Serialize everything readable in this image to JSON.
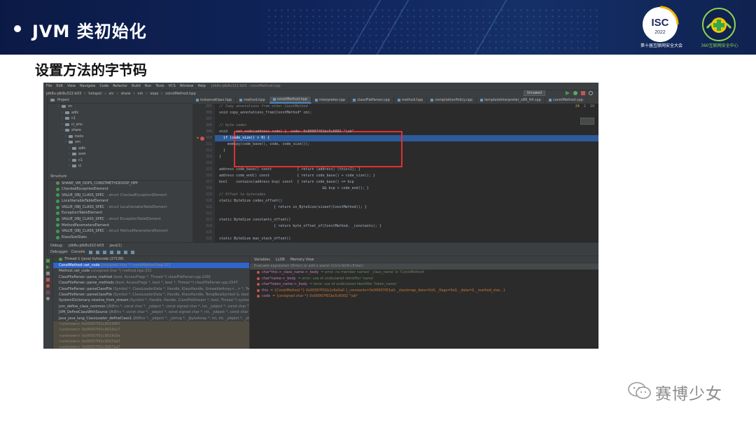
{
  "slide": {
    "title": "JVM 类初始化",
    "subtitle": "设置方法的字节码",
    "logos": {
      "isc_text": "ISC",
      "isc_year": "2022",
      "isc_caption": "第十届互联网安全大会",
      "caption_360": "360互联网安全中心"
    },
    "watermark": "赛博少女",
    "colors": {
      "banner": "#10245a",
      "accent_green": "#8fd14f"
    }
  },
  "ide": {
    "menu": [
      "File",
      "Edit",
      "View",
      "Navigate",
      "Code",
      "Refactor",
      "Build",
      "Run",
      "Tools",
      "VCS",
      "Window",
      "Help"
    ],
    "window_title": "jdk8u-jdk8u322-b03 - constMethod.hpp",
    "breadcrumb": [
      "jdk8u-jdk8u322-b03",
      "hotspot",
      "src",
      "share",
      "vm",
      "oops",
      "constMethod.hpp"
    ],
    "run_config": "Unnamed",
    "project": {
      "header": "Project",
      "tree": [
        {
          "depth": 3,
          "label": "vn"
        },
        {
          "depth": 4,
          "label": "adlc"
        },
        {
          "depth": 4,
          "label": "c1"
        },
        {
          "depth": 4,
          "label": "ci_env"
        },
        {
          "depth": 4,
          "label": "share"
        },
        {
          "depth": 5,
          "label": "tools"
        },
        {
          "depth": 5,
          "label": "vm"
        },
        {
          "depth": 6,
          "label": "adlc"
        },
        {
          "depth": 6,
          "label": "asm"
        },
        {
          "depth": 6,
          "label": "c1"
        },
        {
          "depth": 6,
          "label": "ci"
        }
      ]
    },
    "structure": {
      "header": "Structure",
      "items": [
        {
          "name": "SHARE_VM_OOPS_CONSTMETHODOOP_HPP",
          "sig": "",
          "color": "#6a8759"
        },
        {
          "name": "CheckedExceptionElement",
          "sig": "",
          "color": "#3d9a55"
        },
        {
          "name": "VALUE_OBJ_CLASS_SPEC",
          "sig": ": struct CheckedExceptionElement",
          "color": "#3d9a55"
        },
        {
          "name": "LocalVariableTableElement",
          "sig": "",
          "color": "#3d9a55"
        },
        {
          "name": "VALUE_OBJ_CLASS_SPEC",
          "sig": ": struct LocalVariableTableElement",
          "color": "#3d9a55"
        },
        {
          "name": "ExceptionTableElement",
          "sig": "",
          "color": "#3d9a55"
        },
        {
          "name": "VALUE_OBJ_CLASS_SPEC",
          "sig": ": struct ExceptionTableElement",
          "color": "#3d9a55"
        },
        {
          "name": "MethodParametersElement",
          "sig": "",
          "color": "#3d9a55"
        },
        {
          "name": "VALUE_OBJ_CLASS_SPEC",
          "sig": ": struct MethodParametersElement",
          "color": "#3d9a55"
        },
        {
          "name": "KlassSizeStats",
          "sig": "",
          "color": "#3d9a55"
        }
      ]
    },
    "tabs": [
      {
        "label": "instanceKlass.hpp",
        "active": false
      },
      {
        "label": "method.hpp",
        "active": false
      },
      {
        "label": "constMethod.hpp",
        "active": true
      },
      {
        "label": "interpreter.cpp",
        "active": false
      },
      {
        "label": "classFileParser.cpp",
        "active": false
      },
      {
        "label": "method.hpp",
        "active": false
      },
      {
        "label": "compilationPolicy.cpp",
        "active": false
      },
      {
        "label": "templateInterpreter_x86_64.cpp",
        "active": false
      },
      {
        "label": "constMethod.cpp",
        "active": false
      }
    ],
    "inspect": {
      "warnings": "24",
      "weak": "2",
      "typos": "10"
    },
    "gutter": [
      "305",
      "306",
      "307",
      "308",
      "309",
      "310",
      "311",
      "312",
      "313",
      "314",
      "315",
      "316",
      "317",
      "318",
      "319",
      "320",
      "321",
      "322",
      "323",
      "324",
      "325",
      "326"
    ],
    "code_lines": [
      {
        "text": "  // Copy annotations from other ConstMethod",
        "cls": "cm"
      },
      {
        "text": "  void copy_annotations_from(ConstMethod* cm);",
        "cls": ""
      },
      {
        "text": "",
        "cls": ""
      },
      {
        "text": "  // byte codes",
        "cls": "cm"
      },
      {
        "text": "  void    set_code(address code) {  code: 0x00007f01bc5c6002 \"\\xb\"",
        "cls": ""
      },
      {
        "text": "    if (code_size() > 0) {",
        "cls": "hl"
      },
      {
        "text": "      memcpy(code_base(), code, code_size());",
        "cls": ""
      },
      {
        "text": "    }",
        "cls": ""
      },
      {
        "text": "  }",
        "cls": ""
      },
      {
        "text": "",
        "cls": ""
      },
      {
        "text": "  address code_base() const            { return (address) (this+1); }",
        "cls": ""
      },
      {
        "text": "  address code_end() const             { return code_base() + code_size(); }",
        "cls": ""
      },
      {
        "text": "  bool    contains(address bcp) const  { return code_base() <= bcp",
        "cls": ""
      },
      {
        "text": "                                                   && bcp < code_end(); }",
        "cls": ""
      },
      {
        "text": "  // Offset to bytecodes",
        "cls": "cm"
      },
      {
        "text": "  static ByteSize codes_offset()",
        "cls": ""
      },
      {
        "text": "                            { return in_ByteSize(sizeof(ConstMethod)); }",
        "cls": ""
      },
      {
        "text": "",
        "cls": ""
      },
      {
        "text": "  static ByteSize constants_offset()",
        "cls": ""
      },
      {
        "text": "                            { return byte_offset_of(ConstMethod, _constants); }",
        "cls": ""
      },
      {
        "text": "",
        "cls": ""
      },
      {
        "text": "  static ByteSize max_stack_offset()",
        "cls": ""
      }
    ],
    "editor_crumb": [
      "ConstMethod",
      "set_code"
    ],
    "debug": {
      "tabs": [
        "Debug:",
        "jdk8u-jdk8u322-b03",
        "java(1)"
      ],
      "toolbar": [
        "Debugger",
        "Console"
      ],
      "thread": "Thread-1 (java) bytecode (27138)",
      "frames": [
        {
          "fn": "ConstMethod::set_code",
          "loc": "(unsigned char *) constMethod.hpp:321",
          "kind": "sel"
        },
        {
          "fn": "Method::set_code",
          "loc": "(unsigned char *) method.hpp:331",
          "kind": ""
        },
        {
          "fn": "ClassFileParser::parse_method",
          "loc": "(bool, AccessFlags *, Thread *) classFileParser.cpp:2281",
          "kind": ""
        },
        {
          "fn": "ClassFileParser::parse_methods",
          "loc": "(bool, AccessFlags *, bool *, bool *, Thread *) classFileParser.cpp:2547",
          "kind": ""
        },
        {
          "fn": "ClassFileParser::parseClassFile",
          "loc": "(Symbol *, ClassLoaderData *, Handle, KlassHandle, GrowableArray<...> *, TempNewSymbol &, bool, Thread *) classFileParser.cpp",
          "kind": ""
        },
        {
          "fn": "ClassFileParser::parseClassFile",
          "loc": "(Symbol *, ClassLoaderData *, Handle, KlassHandle, TempNewSymbol &, bool, Thread *)",
          "kind": ""
        },
        {
          "fn": "SystemDictionary::resolve_from_stream",
          "loc": "(Symbol *, Handle, Handle, ClassFileStream *, bool, Thread *) systemDictionary.cpp",
          "kind": ""
        },
        {
          "fn": "jvm_define_class_common",
          "loc": "(JNIEnv *, const char *, _jobject *, const signed char *, int, _jobject *, const char *, unsigned",
          "kind": ""
        },
        {
          "fn": "JVM_DefineClassWithSource",
          "loc": "(JNIEnv *, const char *, _jobject *, const signed char *, int, _jobject *, const char *) jvm.cpp",
          "kind": ""
        },
        {
          "fn": "Java_java_lang_ClassLoader_defineClass1",
          "loc": "(JNIEnv *, _jobject *, _jstring *, _jbyteArray *, int, int, _jobject *, _jstring *)",
          "kind": ""
        },
        {
          "fn": "<unknown> 0x00007f01c9019987",
          "loc": "",
          "kind": "lib"
        },
        {
          "fn": "<unknown> 0x00007f01c9019a17",
          "loc": "",
          "kind": "lib"
        },
        {
          "fn": "<unknown> 0x00007f01c9019c5e",
          "loc": "",
          "kind": "lib"
        },
        {
          "fn": "<unknown> 0x00007f01c9007ad7",
          "loc": "",
          "kind": "lib"
        },
        {
          "fn": "<unknown> 0x00007f01c9007ad7",
          "loc": "",
          "kind": "lib"
        }
      ],
      "vars_tabs": [
        "Variables",
        "LLDB",
        "Memory View"
      ],
      "eval_placeholder": "Evaluate expression (Enter) or add a watch (Ctrl+Shift+Enter)",
      "variables": [
        {
          "name": "char*this->_class_name->_body",
          "value": "= error: no member named '_class_name' in 'ConstMethod'"
        },
        {
          "name": "char*name->_body",
          "value": "= error: use of undeclared identifier 'name'"
        },
        {
          "name": "char*token_name->_body",
          "value": "= error: use of undeclared identifier 'token_name'"
        },
        {
          "name": "this",
          "value": "= {ConstMethod *} 0x00007f01b1c6e0a0 {_constants=0x00007f01a0, _stackmap_data=0x0, _flags=0x0, _data=0, _method_size...}"
        },
        {
          "name": "code",
          "value": "= {unsigned char *} 0x00007f01bc5c6002 \"\\xb\""
        }
      ]
    }
  }
}
